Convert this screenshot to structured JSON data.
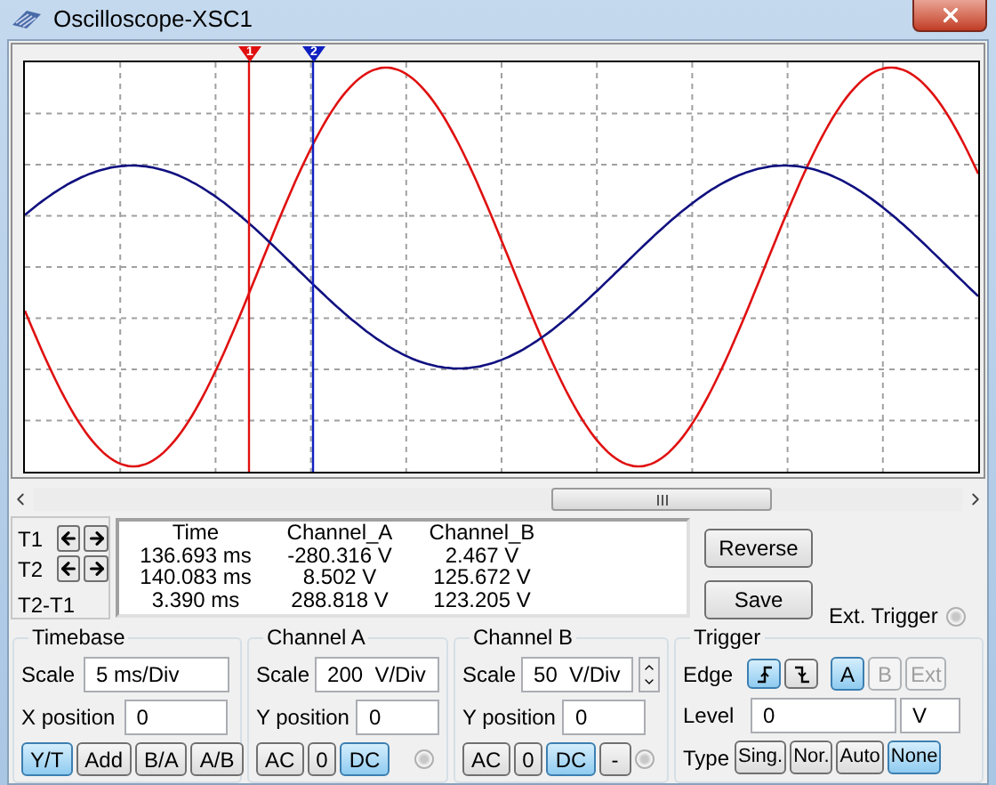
{
  "window": {
    "title": "Oscilloscope-XSC1"
  },
  "cursors": [
    {
      "label": "1",
      "color": "#e01010"
    },
    {
      "label": "2",
      "color": "#1020c0"
    }
  ],
  "cursor_controls": {
    "rows": [
      "T1",
      "T2"
    ],
    "difference_label": "T2-T1"
  },
  "readout": {
    "columns": [
      "Time",
      "Channel_A",
      "Channel_B"
    ],
    "rows": [
      [
        "136.693 ms",
        "-280.316 V",
        "2.467 V"
      ],
      [
        "140.083 ms",
        "8.502 V",
        "125.672 V"
      ],
      [
        "3.390 ms",
        "288.818 V",
        "123.205 V"
      ]
    ]
  },
  "buttons": [
    "Reverse",
    "Save"
  ],
  "ext_trigger": {
    "label": "Ext. Trigger",
    "selected": false
  },
  "timebase": {
    "title": "Timebase",
    "scale_label": "Scale",
    "scale_value": "5 ms/Div",
    "position_label": "X position",
    "position_value": "0",
    "modes": [
      {
        "label": "Y/T",
        "selected": true
      },
      {
        "label": "Add",
        "selected": false
      },
      {
        "label": "B/A",
        "selected": false
      },
      {
        "label": "A/B",
        "selected": false
      }
    ]
  },
  "channels": [
    {
      "title": "Channel A",
      "scale_label": "Scale",
      "scale_value": "200  V/Div",
      "position_label": "Y position",
      "position_value": "0",
      "spin": false,
      "indicator_selected": false,
      "coupling": [
        {
          "label": "AC",
          "selected": false
        },
        {
          "label": "0",
          "selected": false
        },
        {
          "label": "DC",
          "selected": true
        }
      ]
    },
    {
      "title": "Channel B",
      "scale_label": "Scale",
      "scale_value": "50  V/Div",
      "position_label": "Y position",
      "position_value": "0",
      "spin": true,
      "indicator_selected": false,
      "coupling": [
        {
          "label": "AC",
          "selected": false
        },
        {
          "label": "0",
          "selected": false
        },
        {
          "label": "DC",
          "selected": true
        },
        {
          "label": "-",
          "selected": false
        }
      ]
    }
  ],
  "trigger": {
    "title": "Trigger",
    "edge_label": "Edge",
    "edges": [
      {
        "kind": "rising",
        "selected": true
      },
      {
        "kind": "falling",
        "selected": false
      }
    ],
    "sources": [
      {
        "label": "A",
        "selected": true,
        "disabled": false
      },
      {
        "label": "B",
        "selected": false,
        "disabled": true
      },
      {
        "label": "Ext",
        "selected": false,
        "disabled": true
      }
    ],
    "level_label": "Level",
    "level_value": "0",
    "level_unit": "V",
    "type_label": "Type",
    "types": [
      {
        "label": "Sing.",
        "selected": false
      },
      {
        "label": "Nor.",
        "selected": false
      },
      {
        "label": "Auto",
        "selected": false
      },
      {
        "label": "None",
        "selected": true
      }
    ]
  }
}
